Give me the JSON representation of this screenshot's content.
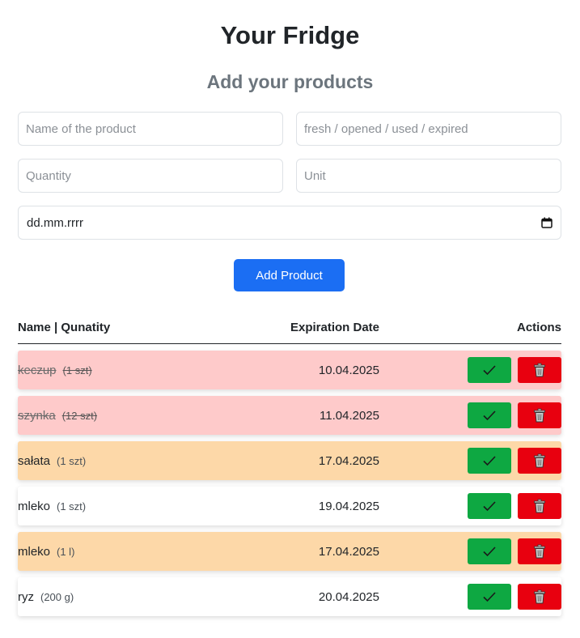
{
  "header": {
    "title": "Your Fridge",
    "subtitle": "Add your products"
  },
  "form": {
    "name_placeholder": "Name of the product",
    "status_placeholder": "fresh / opened / used / expired",
    "quantity_placeholder": "Quantity",
    "unit_placeholder": "Unit",
    "date_value": "dd.mm.rrrr",
    "add_button_label": "Add Product"
  },
  "table": {
    "columns": {
      "name": "Name | Qunatity",
      "date": "Expiration Date",
      "actions": "Actions"
    },
    "rows": [
      {
        "name": "keczup",
        "qty": "(1 szt)",
        "date": "10.04.2025",
        "status": "expired"
      },
      {
        "name": "szynka",
        "qty": "(12 szt)",
        "date": "11.04.2025",
        "status": "expired"
      },
      {
        "name": "sałata",
        "qty": "(1 szt)",
        "date": "17.04.2025",
        "status": "opened"
      },
      {
        "name": "mleko",
        "qty": "(1 szt)",
        "date": "19.04.2025",
        "status": "fresh"
      },
      {
        "name": "mleko",
        "qty": "(1 l)",
        "date": "17.04.2025",
        "status": "opened"
      },
      {
        "name": "ryz",
        "qty": "(200 g)",
        "date": "20.04.2025",
        "status": "fresh"
      }
    ]
  },
  "colors": {
    "primary": "#1b6ef3",
    "done": "#0ea842",
    "delete": "#e8000f",
    "expired_row": "#fecaca",
    "opened_row": "#fdd8a8"
  },
  "icons": {
    "done": "check-icon",
    "delete": "trash-icon",
    "date": "calendar-icon"
  }
}
